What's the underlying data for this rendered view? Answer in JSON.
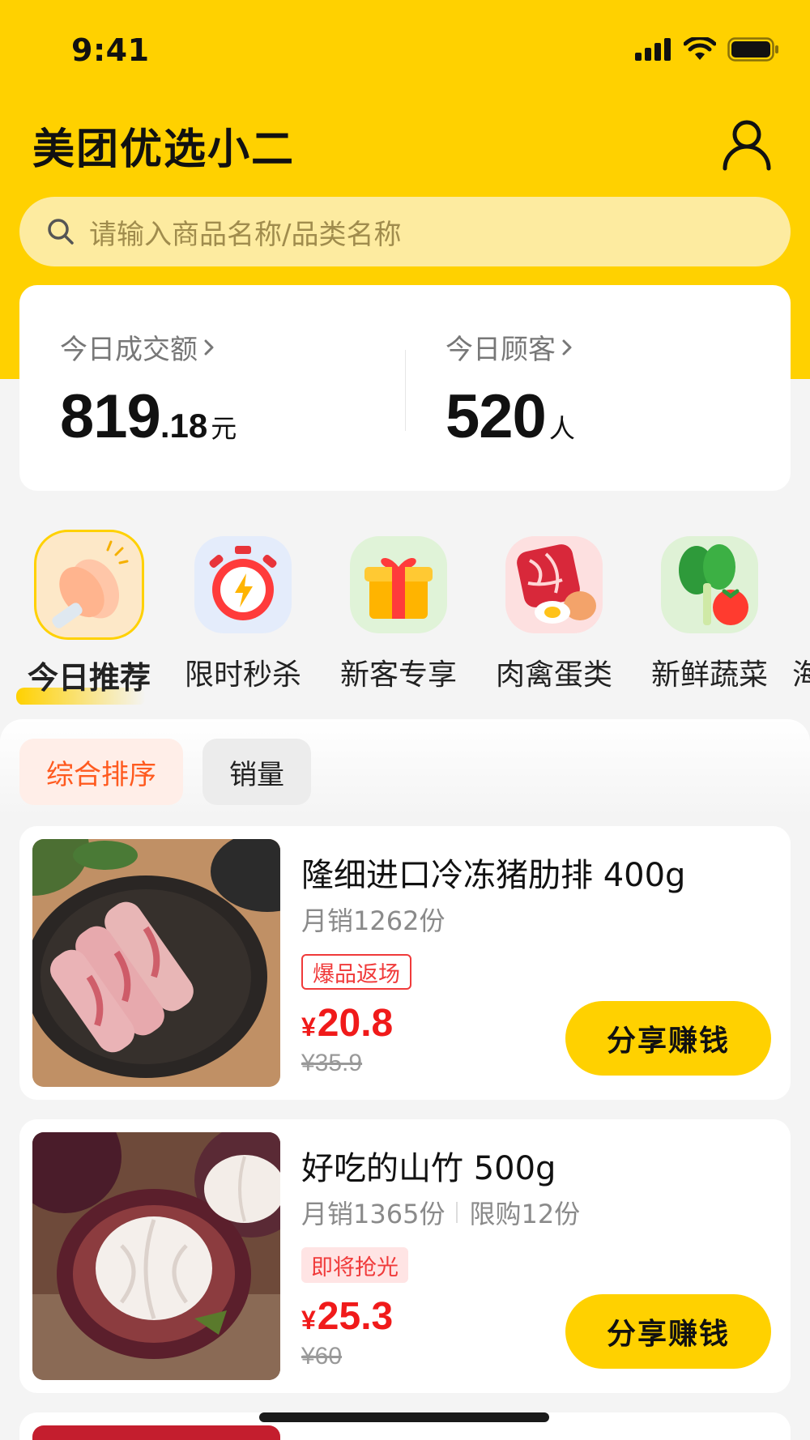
{
  "status_bar": {
    "time": "9:41"
  },
  "header": {
    "title": "美团优选小二"
  },
  "search": {
    "placeholder": "请输入商品名称/品类名称"
  },
  "stats": {
    "sales": {
      "label": "今日成交额",
      "value_int": "819",
      "value_dec": ".18",
      "unit": "元"
    },
    "customers": {
      "label": "今日顾客",
      "value": "520",
      "unit": "人"
    }
  },
  "categories": [
    {
      "label": "今日推荐",
      "icon": "clapping-hands-icon",
      "active": true
    },
    {
      "label": "限时秒杀",
      "icon": "stopwatch-icon",
      "active": false
    },
    {
      "label": "新客专享",
      "icon": "gift-box-icon",
      "active": false
    },
    {
      "label": "肉禽蛋类",
      "icon": "meat-egg-icon",
      "active": false
    },
    {
      "label": "新鲜蔬菜",
      "icon": "vegetable-icon",
      "active": false
    },
    {
      "label": "海",
      "icon": "",
      "active": false
    }
  ],
  "sort_tabs": [
    {
      "label": "综合排序",
      "active": true
    },
    {
      "label": "销量",
      "active": false
    }
  ],
  "products": [
    {
      "name": "隆细进口冷冻猪肋排 400g",
      "monthly_sales": "月销1262份",
      "limit": "",
      "tag": "爆品返场",
      "currency": "¥",
      "price": "20.8",
      "original_price": "¥35.9",
      "share_label": "分享赚钱"
    },
    {
      "name": "好吃的山竹 500g",
      "monthly_sales": "月销1365份",
      "limit": "限购12份",
      "tag": "即将抢光",
      "currency": "¥",
      "price": "25.3",
      "original_price": "¥60",
      "share_label": "分享赚钱"
    }
  ],
  "colors": {
    "brand_yellow": "#ffd100",
    "price_red": "#f01a1a",
    "sort_active": "#ff5a1f"
  }
}
